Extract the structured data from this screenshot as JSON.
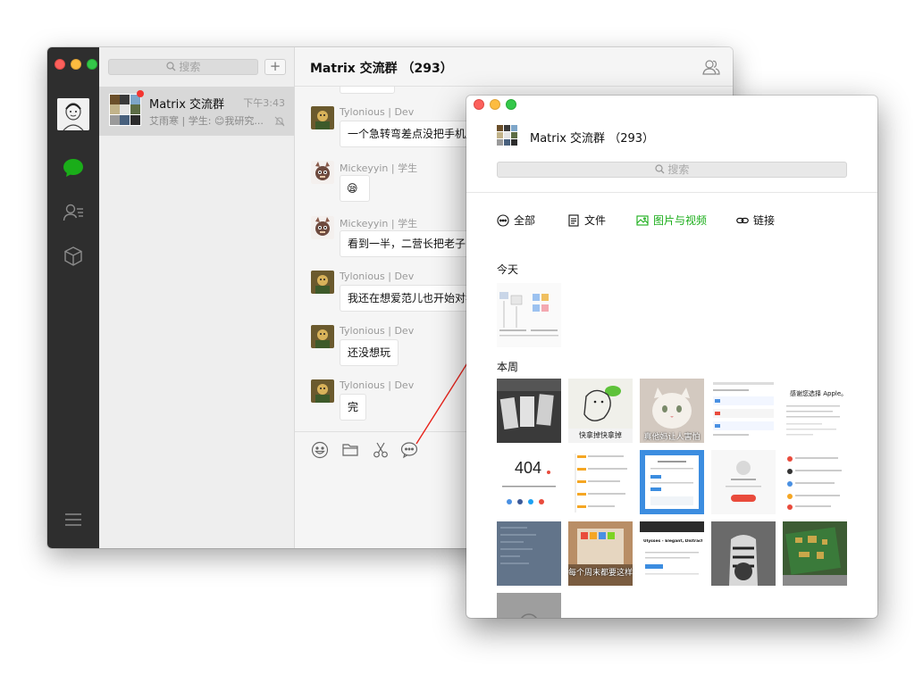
{
  "main_window": {
    "sidebar": {
      "search_placeholder": "搜索",
      "add_label": "+"
    },
    "chat_item": {
      "name": "Matrix 交流群",
      "time": "下午3:43",
      "preview": "艾雨寒 | 学生: 😊我研究..."
    },
    "conversation": {
      "title": "Matrix 交流群 （293）",
      "messages": [
        {
          "sender": "Tylonious | Dev",
          "text": "一个急转弯差点没把手机甩"
        },
        {
          "sender": "Mickeyyin | 学生",
          "text": "😪"
        },
        {
          "sender": "Mickeyyin | 学生",
          "text": "看到一半，二营长把老子的"
        },
        {
          "sender": "Tylonious | Dev",
          "text": "我还在想爱范儿也开始对猫"
        },
        {
          "sender": "Tylonious | Dev",
          "text": "还没想玩"
        },
        {
          "sender": "Tylonious | Dev",
          "text": "完"
        }
      ]
    }
  },
  "media_window": {
    "title": "Matrix 交流群 （293）",
    "search_placeholder": "搜索",
    "tabs": [
      {
        "label": "全部",
        "icon": "chat-icon",
        "active": false
      },
      {
        "label": "文件",
        "icon": "file-icon",
        "active": false
      },
      {
        "label": "图片与视频",
        "icon": "image-icon",
        "active": true
      },
      {
        "label": "链接",
        "icon": "link-icon",
        "active": false
      }
    ],
    "sections": {
      "today": "今天",
      "this_week": "本周"
    },
    "thumb_texts": {
      "t3": "快拿掉快拿掉",
      "t4": "真他妈让人害怕",
      "t6": "感谢您选择 Apple。",
      "t7": "404",
      "t13": "Ulysses - Elegant, Distraction Free Wr",
      "t12": "每个周末都要这样"
    }
  },
  "colors": {
    "accent_green": "#1aad19",
    "rail_bg": "#2e2e2e",
    "badge_red": "#f43530"
  }
}
